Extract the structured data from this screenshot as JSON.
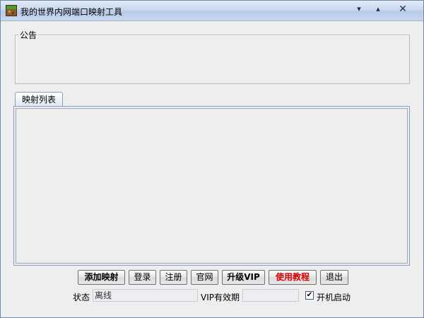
{
  "window": {
    "title": "我的世界内网端口映射工具",
    "controls": {
      "menu": "▾",
      "minimize": "▴",
      "close": "✕"
    }
  },
  "notice": {
    "legend": "公告"
  },
  "tabs": [
    {
      "label": "映射列表",
      "active": true
    }
  ],
  "buttons": {
    "add_mapping": "添加映射",
    "login": "登录",
    "register": "注册",
    "official_site": "官网",
    "upgrade_vip": "升级VIP",
    "tutorial": "使用教程",
    "exit": "退出"
  },
  "status": {
    "label": "状态",
    "value": "离线",
    "vip_label": "VIP有效期",
    "vip_value": "",
    "autostart_label": "开机启动",
    "autostart_checked": true,
    "checkmark": "✔"
  },
  "colors": {
    "tutorial_text": "#d40000"
  }
}
